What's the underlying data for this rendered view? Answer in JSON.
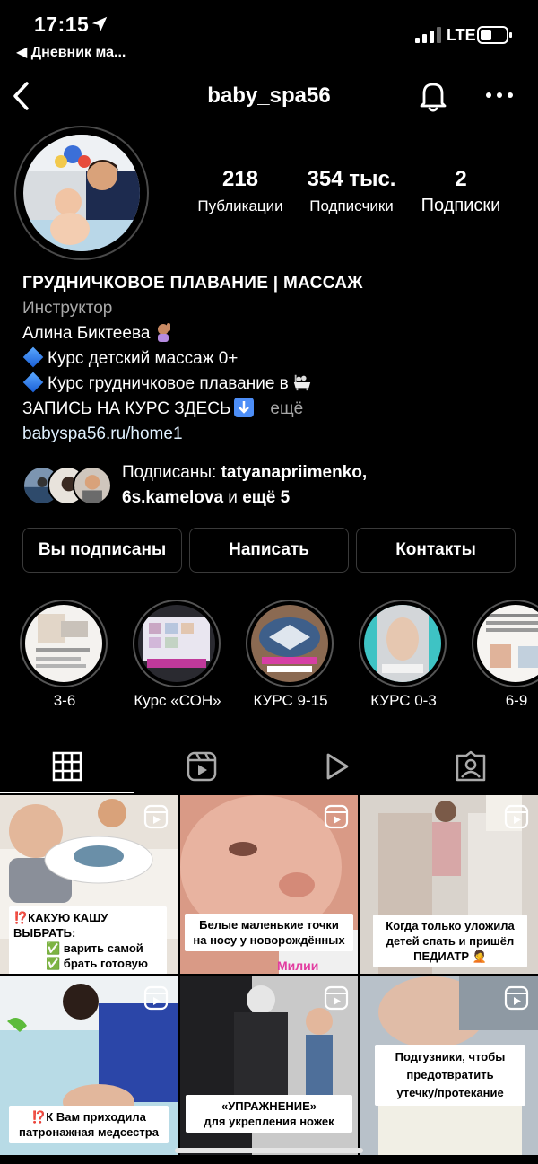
{
  "status_bar": {
    "time": "17:15",
    "back_app": "◀ Дневник ма...",
    "network": "LTE"
  },
  "nav": {
    "username": "baby_spa56"
  },
  "stats": [
    {
      "value": "218",
      "label": "Публикации"
    },
    {
      "value": "354 тыс.",
      "label": "Подписчики"
    },
    {
      "value": "2",
      "label": "Подписки"
    }
  ],
  "bio": {
    "name": "ГРУДНИЧКОВОЕ ПЛАВАНИЕ | МАССАЖ",
    "category": "Инструктор",
    "line1": "Алина Биктеева",
    "line2": "Курс детский массаж 0+",
    "line3": "Курс грудничковое плавание в",
    "line4": "ЗАПИСЬ НА КУРС ЗДЕСЬ",
    "more": "ещё",
    "link": "babyspa56.ru/home1"
  },
  "followed_by": {
    "prefix": "Подписаны: ",
    "user1": "tatyanapriimenko,",
    "user2": "6s.kamelova",
    "middle": " и ",
    "suffix": "ещё 5"
  },
  "buttons": {
    "following": "Вы подписаны",
    "message": "Написать",
    "contacts": "Контакты"
  },
  "highlights": [
    {
      "label": "3-6"
    },
    {
      "label": "Курс «СОН»"
    },
    {
      "label": "КУРС 9-15"
    },
    {
      "label": "КУРС 0-3"
    },
    {
      "label": "6-9"
    }
  ],
  "tabs": [
    {
      "icon": "grid-icon"
    },
    {
      "icon": "reels-icon"
    },
    {
      "icon": "play-icon"
    },
    {
      "icon": "tagged-icon"
    }
  ],
  "posts": {
    "p1_line1": "⁉️КАКУЮ КАШУ ВЫБРАТЬ:",
    "p1_line2": "✅ варить самой",
    "p1_line3": "✅ брать готовую",
    "p2_line1": "Белые маленькие точки",
    "p2_line2": "на носу у новорождённых",
    "p2_tag": "Милии",
    "p3_line1": "Когда только уложила",
    "p3_line2": "детей спать и пришёл",
    "p3_line3": "ПЕДИАТР 🤦",
    "p4_line1": "⁉️К Вам приходила",
    "p4_line2": "патронажная медсестра",
    "p5_line1": "«УПРАЖНЕНИЕ»",
    "p5_line2": "для укрепления ножек",
    "p6_line1": "Подгузники, чтобы",
    "p6_line2": "предотвратить",
    "p6_line3": "утечку/протекание"
  },
  "colors": {
    "background": "#000000",
    "muted_text": "#a8a8a8",
    "link_text": "#e0f1ff",
    "button_border": "#3a3a3a"
  }
}
